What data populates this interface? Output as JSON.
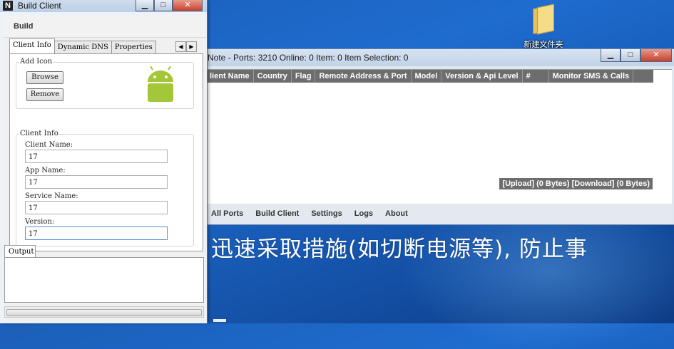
{
  "desktop": {
    "folder_label": "新建文件夹",
    "overlay_text": "迅速采取措施(如切断电源等), 防止事"
  },
  "main_window": {
    "title": "Note - Ports: 3210 Online: 0 Item: 0 Item Selection: 0",
    "columns": [
      "lient Name",
      "Country",
      "Flag",
      "Remote Address & Port",
      "Model",
      "Version & Api Level",
      "#",
      "Monitor SMS & Calls"
    ],
    "transfer_status": "[Upload] (0 Bytes) [Download] (0 Bytes)",
    "menu": [
      "All Ports",
      "Build Client",
      "Settings",
      "Logs",
      "About"
    ],
    "buttons": {
      "minimize": "▁",
      "maximize": "□",
      "close": "✕"
    }
  },
  "build_window": {
    "logo": "N",
    "title": "Build Client",
    "buttons": {
      "minimize": "▁",
      "maximize": "□",
      "close": "✕"
    },
    "menu": [
      "Build"
    ],
    "tabs": [
      "Client Info",
      "Dynamic DNS",
      "Properties"
    ],
    "active_tab": "Client Info",
    "add_icon": {
      "label": "Add Icon",
      "browse": "Browse",
      "remove": "Remove"
    },
    "client_info": {
      "label": "Client Info",
      "fields": [
        {
          "label": "Client Name:",
          "value": "17"
        },
        {
          "label": "App Name:",
          "value": "17"
        },
        {
          "label": "Service Name:",
          "value": "17"
        },
        {
          "label": "Version:",
          "value": "17"
        }
      ]
    },
    "output_tab": "Output"
  },
  "colors": {
    "android_green": "#a4c639",
    "header_gray": "#6d6d6d",
    "desktop_blue": "#1e6ccf"
  }
}
